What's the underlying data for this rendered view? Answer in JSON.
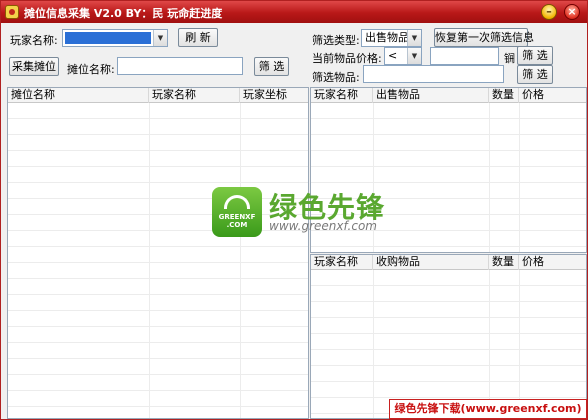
{
  "titlebar": {
    "title": "摊位信息采集 V2.0   BY：民  玩命赶进度",
    "min_glyph": "–",
    "close_glyph": "×",
    "app_icon": "app-icon"
  },
  "left_controls": {
    "player_name_label": "玩家名称:",
    "player_name_value": "",
    "refresh_label": "刷 新",
    "collect_button": "采集摊位",
    "stall_name_label": "摊位名称:",
    "stall_name_value": "",
    "stall_filter_button": "筛 选"
  },
  "right_controls": {
    "filter_type_label": "筛选类型:",
    "filter_type_value": "出售物品",
    "restore_button": "恢复第一次筛选信息",
    "price_label": "当前物品价格:",
    "price_operator": "<",
    "price_value": "",
    "price_unit": "锎",
    "price_filter_button": "筛 选",
    "item_filter_label": "筛选物品:",
    "item_filter_value": "",
    "item_filter_button": "筛 选"
  },
  "stall_table": {
    "columns": [
      "摊位名称",
      "玩家名称",
      "玩家坐标"
    ]
  },
  "sell_table": {
    "columns": [
      "玩家名称",
      "出售物品",
      "数量",
      "价格"
    ]
  },
  "buy_table": {
    "columns": [
      "玩家名称",
      "收购物品",
      "数量",
      "价格"
    ]
  },
  "watermark": {
    "logo_text": "GREENXF\n.COM",
    "name": "绿色先锋",
    "url": "www.greenxf.com"
  },
  "banner": {
    "text": "绿色先锋下载(www.greenxf.com)"
  },
  "colors": {
    "titlebar": "#b81818",
    "selection": "#2a6fd6",
    "watermark_green": "#5aa830"
  }
}
